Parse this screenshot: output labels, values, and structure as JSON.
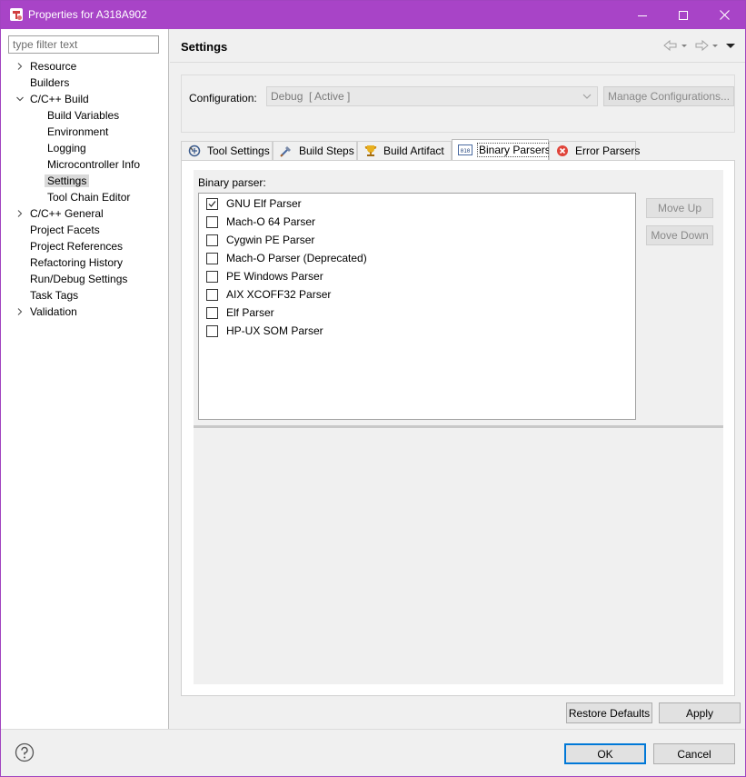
{
  "window": {
    "title": "Properties for A318A902",
    "titlebar_color": "#a844c7"
  },
  "filter": {
    "placeholder": "type filter text"
  },
  "tree": [
    {
      "label": "Resource",
      "expander": "collapsed"
    },
    {
      "label": "Builders",
      "expander": "none"
    },
    {
      "label": "C/C++ Build",
      "expander": "expanded"
    },
    {
      "label": "Build Variables",
      "child": true
    },
    {
      "label": "Environment",
      "child": true
    },
    {
      "label": "Logging",
      "child": true
    },
    {
      "label": "Microcontroller Info",
      "child": true
    },
    {
      "label": "Settings",
      "child": true,
      "selected": true
    },
    {
      "label": "Tool Chain Editor",
      "child": true
    },
    {
      "label": "C/C++ General",
      "expander": "collapsed"
    },
    {
      "label": "Project Facets",
      "expander": "none"
    },
    {
      "label": "Project References",
      "expander": "none"
    },
    {
      "label": "Refactoring History",
      "expander": "none"
    },
    {
      "label": "Run/Debug Settings",
      "expander": "none"
    },
    {
      "label": "Task Tags",
      "expander": "none"
    },
    {
      "label": "Validation",
      "expander": "collapsed"
    }
  ],
  "header": {
    "title": "Settings"
  },
  "configuration": {
    "label": "Configuration:",
    "value": "Debug  [ Active ]",
    "manage_label": "Manage Configurations..."
  },
  "tabs": [
    {
      "label": "Tool Settings",
      "icon": "tool-settings-icon"
    },
    {
      "label": "Build Steps",
      "icon": "build-steps-icon"
    },
    {
      "label": "Build Artifact",
      "icon": "trophy-icon"
    },
    {
      "label": "Binary Parsers",
      "icon": "binary-icon",
      "active": true
    },
    {
      "label": "Error Parsers",
      "icon": "error-icon"
    }
  ],
  "binary_parsers": {
    "label": "Binary parser:",
    "items": [
      {
        "label": "GNU Elf Parser",
        "checked": true
      },
      {
        "label": "Mach-O 64 Parser",
        "checked": false
      },
      {
        "label": "Cygwin PE Parser",
        "checked": false
      },
      {
        "label": "Mach-O Parser (Deprecated)",
        "checked": false
      },
      {
        "label": "PE Windows Parser",
        "checked": false
      },
      {
        "label": "AIX XCOFF32 Parser",
        "checked": false
      },
      {
        "label": "Elf Parser",
        "checked": false
      },
      {
        "label": "HP-UX SOM Parser",
        "checked": false
      }
    ],
    "move_up_label": "Move Up",
    "move_down_label": "Move Down"
  },
  "buttons": {
    "restore_defaults": "Restore Defaults",
    "apply": "Apply",
    "ok": "OK",
    "cancel": "Cancel"
  }
}
